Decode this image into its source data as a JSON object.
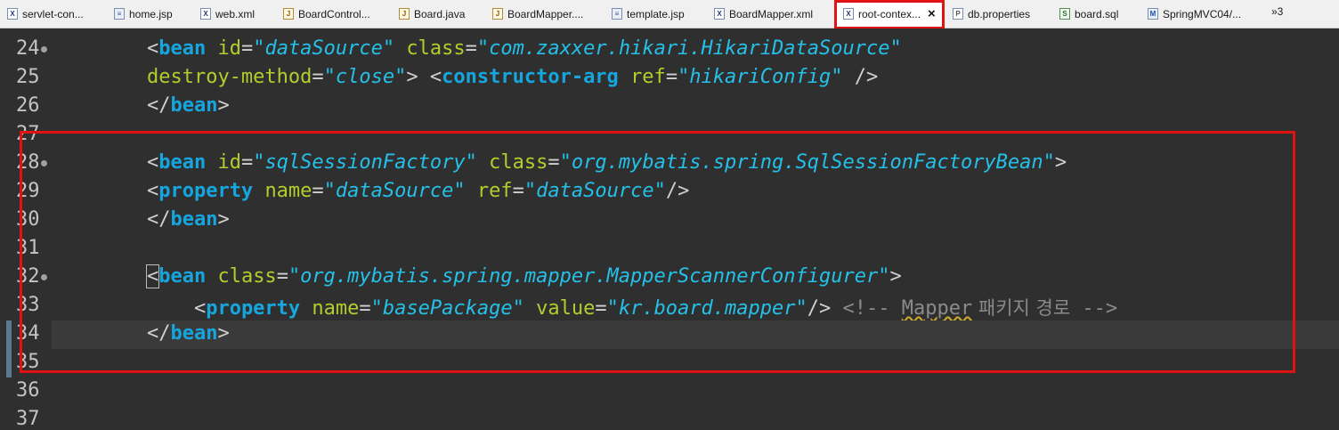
{
  "tabs": [
    {
      "label": "servlet-con...",
      "icon": "xml-file-icon"
    },
    {
      "label": "home.jsp",
      "icon": "jsp-file-icon"
    },
    {
      "label": "web.xml",
      "icon": "xml-file-icon"
    },
    {
      "label": "BoardControl...",
      "icon": "java-file-icon"
    },
    {
      "label": "Board.java",
      "icon": "java-file-icon"
    },
    {
      "label": "BoardMapper....",
      "icon": "java-file-icon"
    },
    {
      "label": "template.jsp",
      "icon": "jsp-file-icon"
    },
    {
      "label": "BoardMapper.xml",
      "icon": "xml-file-icon"
    },
    {
      "label": "root-contex...",
      "icon": "xml-file-icon",
      "active": true
    },
    {
      "label": "db.properties",
      "icon": "properties-file-icon"
    },
    {
      "label": "board.sql",
      "icon": "sql-file-icon"
    },
    {
      "label": "SpringMVC04/...",
      "icon": "mvc-file-icon"
    }
  ],
  "tab_overflow": "»3",
  "active_tab_close": "×",
  "editor": {
    "lines": [
      {
        "num": "24",
        "fold": true
      },
      {
        "num": "25"
      },
      {
        "num": "26"
      },
      {
        "num": "27"
      },
      {
        "num": "28",
        "fold": true
      },
      {
        "num": "29"
      },
      {
        "num": "30"
      },
      {
        "num": "31"
      },
      {
        "num": "32",
        "fold": true
      },
      {
        "num": "33"
      },
      {
        "num": "34",
        "current": true
      },
      {
        "num": "35"
      },
      {
        "num": "36"
      },
      {
        "num": "37"
      }
    ],
    "code": {
      "l24": {
        "indent": "        ",
        "open": "<",
        "tag": "bean",
        "a1": "id",
        "v1": "\"dataSource\"",
        "a2": "class",
        "v2": "\"com.zaxxer.hikari.HikariDataSource\""
      },
      "l25": {
        "indent": "        ",
        "a1": "destroy-method",
        "v1": "\"close\"",
        "gt": ">",
        "open": "<",
        "tag": "constructor-arg",
        "a2": "ref",
        "v2": "\"hikariConfig\"",
        "close": "/>"
      },
      "l26": {
        "indent": "        ",
        "open": "</",
        "tag": "bean",
        "close": ">"
      },
      "l28": {
        "indent": "        ",
        "open": "<",
        "tag": "bean",
        "a1": "id",
        "v1": "\"sqlSessionFactory\"",
        "a2": "class",
        "v2": "\"org.mybatis.spring.SqlSessionFactoryBean\"",
        "close": ">"
      },
      "l29": {
        "indent": "        ",
        "open": "<",
        "tag": "property",
        "a1": "name",
        "v1": "\"dataSource\"",
        "a2": "ref",
        "v2": "\"dataSource\"",
        "close": "/>"
      },
      "l30": {
        "indent": "        ",
        "open": "</",
        "tag": "bean",
        "close": ">"
      },
      "l32": {
        "indent": "        ",
        "open": "<",
        "tag": "bean",
        "a1": "class",
        "v1": "\"org.mybatis.spring.mapper.MapperScannerConfigurer\"",
        "close": ">"
      },
      "l33": {
        "indent": "            ",
        "open": "<",
        "tag": "property",
        "a1": "name",
        "v1": "\"basePackage\"",
        "a2": "value",
        "v2": "\"kr.board.mapper\"",
        "close": "/>",
        "comment_start": "<!-- ",
        "comment_word": "Mapper",
        "comment_ko": " 패키지 경로",
        "comment_end": " -->"
      },
      "l34": {
        "indent": "        ",
        "open": "</",
        "tag": "bean",
        "close": ">"
      }
    }
  },
  "colors": {
    "highlight": "#e01212",
    "tag": "#16a6df",
    "attribute": "#b5cc2c",
    "value": "#25c0e8",
    "comment": "#8a8a8a",
    "background": "#2f2f2f"
  }
}
